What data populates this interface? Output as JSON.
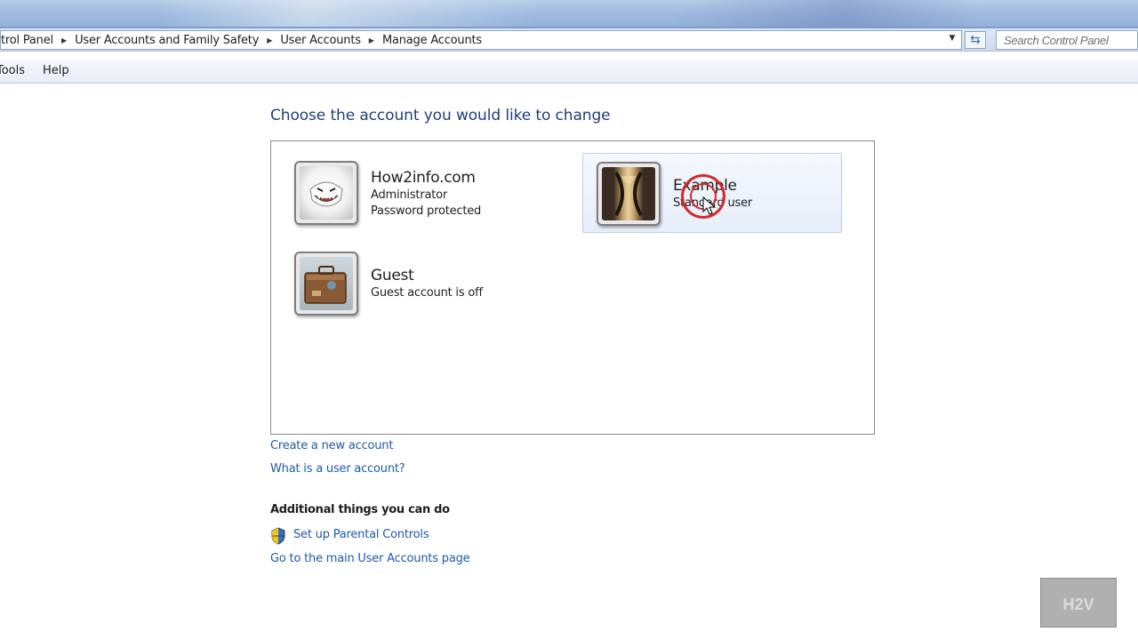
{
  "address_bar": {
    "breadcrumbs": [
      "trol Panel",
      "User Accounts and Family Safety",
      "User Accounts",
      "Manage Accounts"
    ]
  },
  "search": {
    "placeholder": "Search Control Panel"
  },
  "menu": {
    "items": [
      "Tools",
      "Help"
    ]
  },
  "main": {
    "title": "Choose the account you would like to change",
    "accounts": [
      {
        "name": "How2info.com",
        "line1": "Administrator",
        "line2": "Password protected",
        "avatar": "ghost-avatar-icon"
      },
      {
        "name": "Example",
        "line1": "Standard user",
        "avatar": "hourglass-avatar-icon",
        "selected": true
      },
      {
        "name": "Guest",
        "line1": "Guest account is off",
        "avatar": "suitcase-avatar-icon"
      }
    ],
    "links": {
      "create_account": "Create a new account",
      "what_is_account": "What is a user account?"
    },
    "additional": {
      "heading": "Additional things you can do",
      "parental_controls": "Set up Parental Controls",
      "main_accounts_page": "Go to the main User Accounts page"
    }
  },
  "watermark": "H2V",
  "colors": {
    "link": "#1e5aa8",
    "title": "#1e3f7a",
    "click_indicator": "#d42a2a"
  }
}
